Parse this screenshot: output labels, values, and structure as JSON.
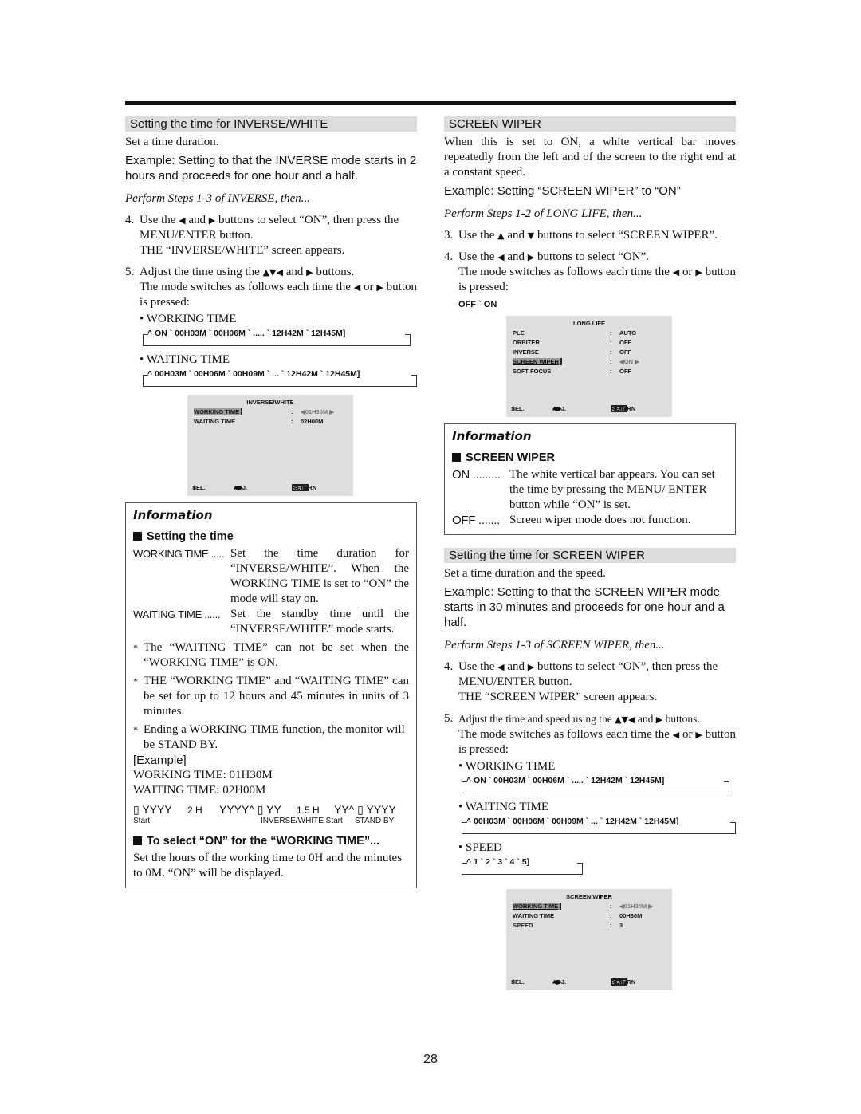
{
  "page_number": "28",
  "left": {
    "section_title": "Setting the time for INVERSE/WHITE",
    "intro": "Set a time duration.",
    "example": "Example: Setting to that the INVERSE mode starts in 2 hours and proceeds for one hour and a half.",
    "perform": "Perform Steps 1-3 of INVERSE, then...",
    "step4": {
      "num": "4.",
      "line1_a": "Use the ",
      "line1_b": " and ",
      "line1_c": " buttons to select “ON”, then press the MENU/ENTER button.",
      "line2": "THE “INVERSE/WHITE” screen appears."
    },
    "step5": {
      "num": "5.",
      "line1_a": "Adjust the time using the ",
      "line1_b": " and ",
      "line1_c": " buttons.",
      "line2_a": "The mode switches as follows each time the ",
      "line2_b": " or ",
      "line2_c": " button is pressed:"
    },
    "working_label": "• WORKING TIME",
    "working_seq": "^ ON  `  00H03M  `  00H06M `  ..... `  12H42M `  12H45M]",
    "waiting_label": "• WAITING TIME",
    "waiting_seq": "^ 00H03M  `  00H06M  `  00H09M `  ... `  12H42M `  12H45M]",
    "osd": {
      "title": "INVERSE/WHITE",
      "rows": [
        {
          "label": "WORKING TIME",
          "colon": ":",
          "value": "◀01H30M ▶",
          "selected": true
        },
        {
          "label": "WAITING TIME",
          "colon": ":",
          "value": "02H00M",
          "selected": false
        }
      ],
      "footer": {
        "sel": "SEL.",
        "adj": "ADJ.",
        "exit": "EXIT",
        "ret": "RETURN"
      }
    },
    "info": {
      "heading": "Information",
      "subheading": "Setting the time",
      "defs": [
        {
          "term": "WORKING TIME .....",
          "desc": "Set the time duration for “INVERSE/WHITE”. When the WORKING TIME is set to “ON” the mode will stay on."
        },
        {
          "term": "WAITING TIME ......",
          "desc": "Set the standby time until the “INVERSE/WHITE” mode starts."
        }
      ],
      "notes": [
        "The “WAITING TIME” can not be set when the “WORKING TIME” is ON.",
        "THE “WORKING TIME” and “WAITING TIME” can be set for up to 12 hours and 45 minutes in units of 3 minutes.",
        "Ending a WORKING TIME function, the monitor will be STAND BY."
      ],
      "example_label": "[Example]",
      "example_working": "WORKING TIME: 01H30M",
      "example_waiting": "WAITING TIME:   02H00M",
      "timeline": {
        "seg1": "▯ YYYY",
        "dur1": "2 H",
        "seg2": "YYYY^ ▯ YY",
        "dur2": "1.5 H",
        "seg3": "YY^ ▯ YYYY",
        "lbl_start": "Start",
        "lbl_inv": "INVERSE/WHITE Start",
        "lbl_standby": "STAND BY"
      },
      "sub2": "To select “ON” for the “WORKING TIME”...",
      "sub2_text": "Set the hours of the working time to 0H and the minutes to 0M. “ON” will be displayed."
    }
  },
  "right": {
    "section_title": "SCREEN WIPER",
    "intro": "When this is set to ON, a white vertical bar moves repeatedly from the left and of the screen to the right end at a constant speed.",
    "example": "Example: Setting “SCREEN WIPER” to “ON”",
    "perform": "Perform Steps 1-2 of LONG LIFE, then...",
    "step3": {
      "num": "3.",
      "a": "Use the ",
      "b": " and ",
      "c": " buttons to select “SCREEN WIPER”."
    },
    "step4": {
      "num": "4.",
      "a": "Use the ",
      "b": " and ",
      "c": " buttons to select “ON”.",
      "line2_a": "The mode switches as follows each time the ",
      "line2_b": " or ",
      "line2_c": " button is pressed:"
    },
    "offon": "OFF  `  ON",
    "osd": {
      "title": "LONG LIFE",
      "rows": [
        {
          "label": "PLE",
          "colon": ":",
          "value": "AUTO",
          "selected": false
        },
        {
          "label": "ORBITER",
          "colon": ":",
          "value": "OFF",
          "selected": false
        },
        {
          "label": "INVERSE",
          "colon": ":",
          "value": "OFF",
          "selected": false
        },
        {
          "label": "SCREEN WIPER",
          "colon": ":",
          "value": "◀ON ▶",
          "selected": true
        },
        {
          "label": "SOFT FOCUS",
          "colon": ":",
          "value": "OFF",
          "selected": false
        }
      ],
      "footer": {
        "sel": "SEL.",
        "adj": "ADJ.",
        "exit": "EXIT",
        "ret": "RETURN"
      }
    },
    "info": {
      "heading": "Information",
      "subheading": "SCREEN WIPER",
      "defs": [
        {
          "term": "ON .........",
          "desc": "The white vertical bar appears. You can set the time by pressing the MENU/ ENTER button while “ON” is set."
        },
        {
          "term": "OFF .......",
          "desc": "Screen wiper mode does not function."
        }
      ]
    },
    "section2_title": "Setting the time for SCREEN WIPER",
    "intro2": "Set a time duration and the speed.",
    "example2": "Example: Setting to that the SCREEN WIPER mode starts in 30 minutes and proceeds for one hour and a half.",
    "perform2": "Perform Steps 1-3 of SCREEN WIPER, then...",
    "step4b": {
      "num": "4.",
      "a": "Use the ",
      "b": " and ",
      "c": " buttons to select “ON”, then press the MENU/ENTER button.",
      "line2": "THE “SCREEN WIPER” screen appears."
    },
    "step5b": {
      "num": "5.",
      "a": "Adjust the time and speed using the ",
      "b": " and ",
      "c": " buttons.",
      "line2_a": "The mode switches as follows each time the ",
      "line2_b": " or ",
      "line2_c": " button is pressed:"
    },
    "working_label": "• WORKING TIME",
    "working_seq": "^ ON  `  00H03M  `  00H06M `  ..... `  12H42M `  12H45M]",
    "waiting_label": "• WAITING TIME",
    "waiting_seq": "^ 00H03M  `  00H06M  `  00H09M `  ... `  12H42M `  12H45M]",
    "speed_label": "• SPEED",
    "speed_seq": "^ 1 `  2  `  3 `  4 `  5]",
    "osd2": {
      "title": "SCREEN WIPER",
      "rows": [
        {
          "label": "WORKING TIME",
          "colon": ":",
          "value": "◀01H30M ▶",
          "selected": true
        },
        {
          "label": "WAITING TIME",
          "colon": ":",
          "value": "00H30M",
          "selected": false
        },
        {
          "label": "SPEED",
          "colon": ":",
          "value": "3",
          "selected": false
        }
      ],
      "footer": {
        "sel": "SEL.",
        "adj": "ADJ.",
        "exit": "EXIT",
        "ret": "RETURN"
      }
    }
  }
}
